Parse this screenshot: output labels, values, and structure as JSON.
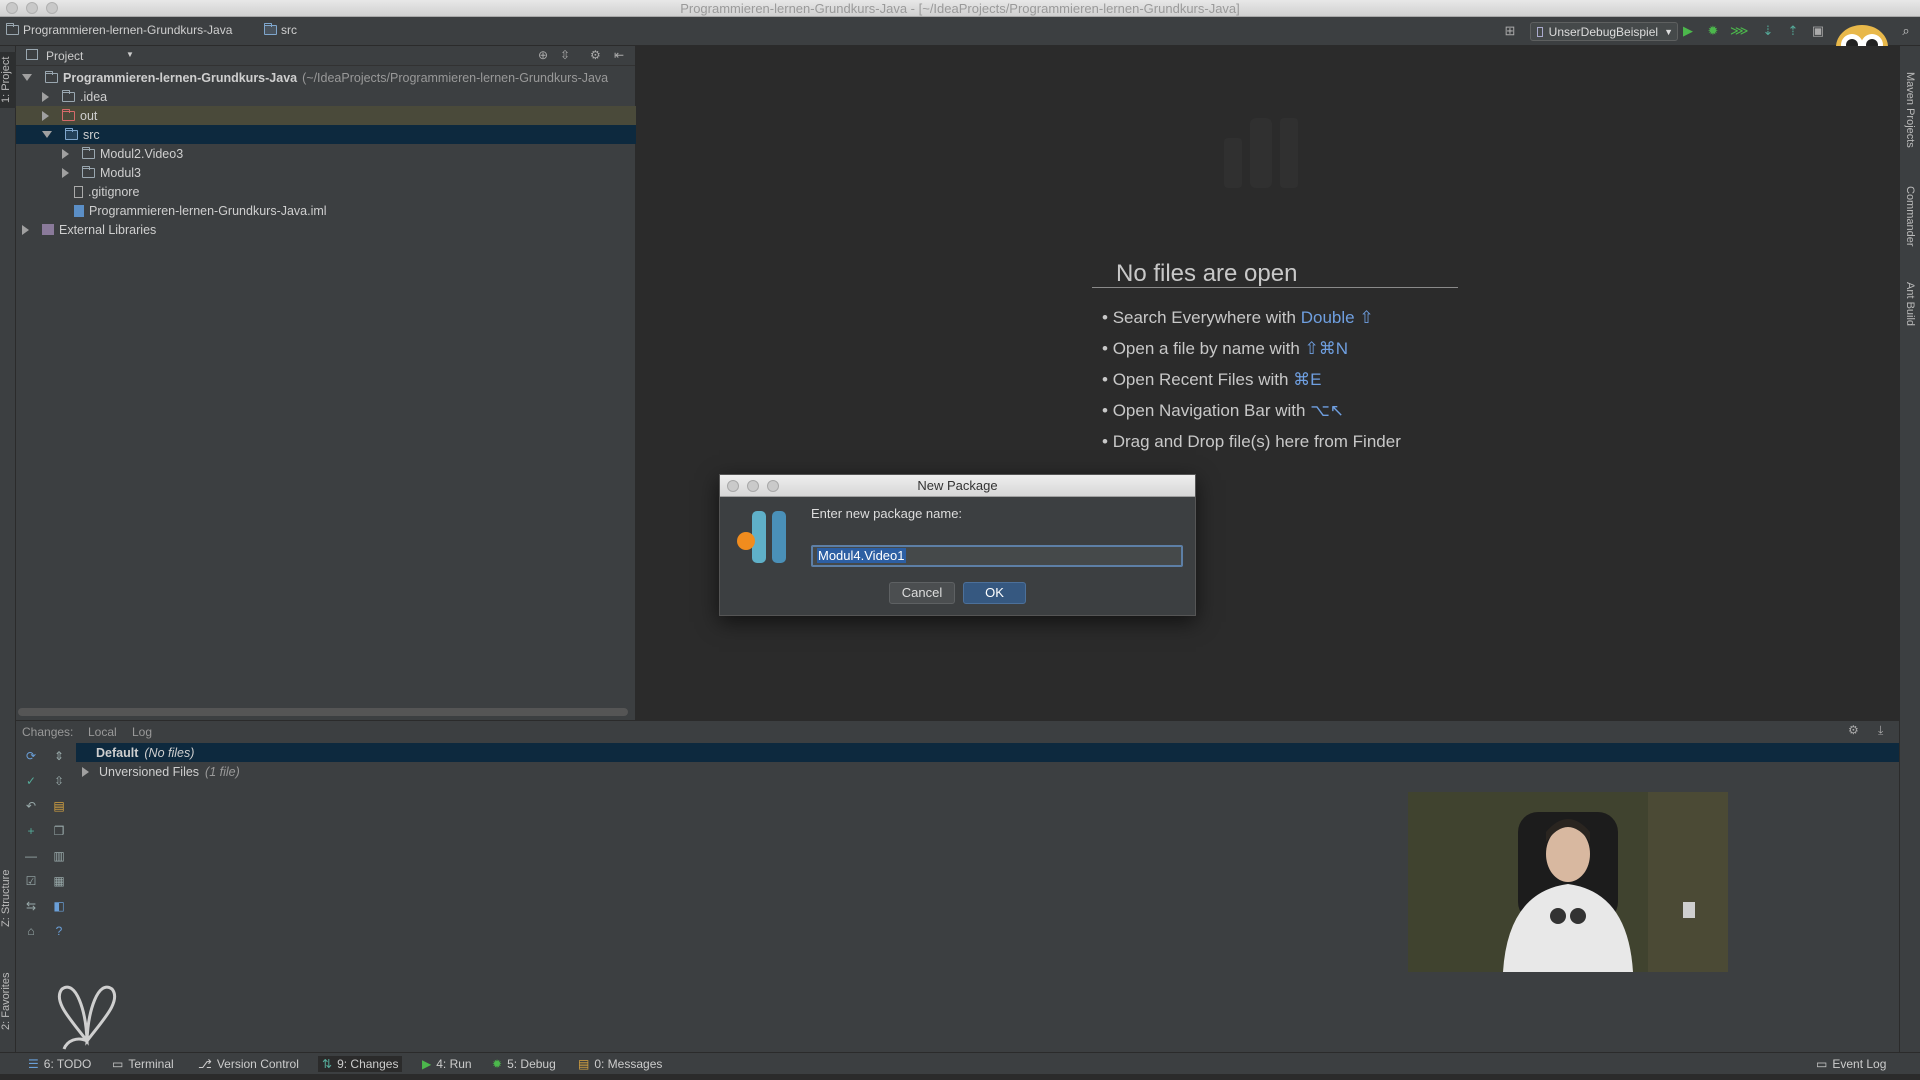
{
  "window": {
    "title": "Programmieren-lernen-Grundkurs-Java - [~/IdeaProjects/Programmieren-lernen-Grundkurs-Java]"
  },
  "navbar": {
    "project_crumb": "Programmieren-lernen-Grundkurs-Java",
    "src_crumb": "src",
    "run_config": "UnserDebugBeispiel"
  },
  "left_tabs": {
    "project": "1: Project",
    "structure": "Z: Structure",
    "favorites": "2: Favorites"
  },
  "right_tabs": {
    "maven": "Maven Projects",
    "commander": "Commander",
    "ant": "Ant Build"
  },
  "project_panel": {
    "header_label": "Project",
    "tree": [
      {
        "label": "Programmieren-lernen-Grundkurs-Java",
        "extra": "(~/IdeaProjects/Programmieren-lernen-Grundkurs-Java",
        "type": "module"
      },
      {
        "label": ".idea",
        "type": "folder"
      },
      {
        "label": "out",
        "type": "folder-excluded"
      },
      {
        "label": "src",
        "type": "source-folder"
      },
      {
        "label": "Modul2.Video3",
        "type": "package"
      },
      {
        "label": "Modul3",
        "type": "package"
      },
      {
        "label": ".gitignore",
        "type": "file"
      },
      {
        "label": "Programmieren-lernen-Grundkurs-Java.iml",
        "type": "iml"
      },
      {
        "label": "External Libraries",
        "type": "libraries"
      }
    ]
  },
  "editor": {
    "empty_title": "No files are open",
    "hints": [
      {
        "text": "Search Everywhere with",
        "key": "Double ⇧"
      },
      {
        "text": "Open a file by name with",
        "key": "⇧⌘N"
      },
      {
        "text": "Open Recent Files with",
        "key": "⌘E"
      },
      {
        "text": "Open Navigation Bar with",
        "key": "⌥↖"
      },
      {
        "text": "Drag and Drop file(s) here from Finder",
        "key": ""
      }
    ]
  },
  "dialog": {
    "title": "New Package",
    "prompt": "Enter new package name:",
    "input_value": "Modul4.Video1",
    "cancel_label": "Cancel",
    "ok_label": "OK"
  },
  "changes_panel": {
    "label": "Changes:",
    "tab_local": "Local",
    "tab_log": "Log",
    "rows": [
      {
        "label": "Default",
        "note": "(No files)"
      },
      {
        "label": "Unversioned Files",
        "note": "(1 file)"
      }
    ]
  },
  "statusbar": {
    "todo": "6: TODO",
    "terminal": "Terminal",
    "version_control": "Version Control",
    "changes": "9: Changes",
    "run": "4: Run",
    "debug": "5: Debug",
    "messages": "0: Messages",
    "event_log": "Event Log"
  },
  "colors": {
    "accent_blue": "#6f9fe0",
    "selection": "#0d293e",
    "panel_bg": "#3c3f41",
    "editor_bg": "#2b2b2b"
  }
}
